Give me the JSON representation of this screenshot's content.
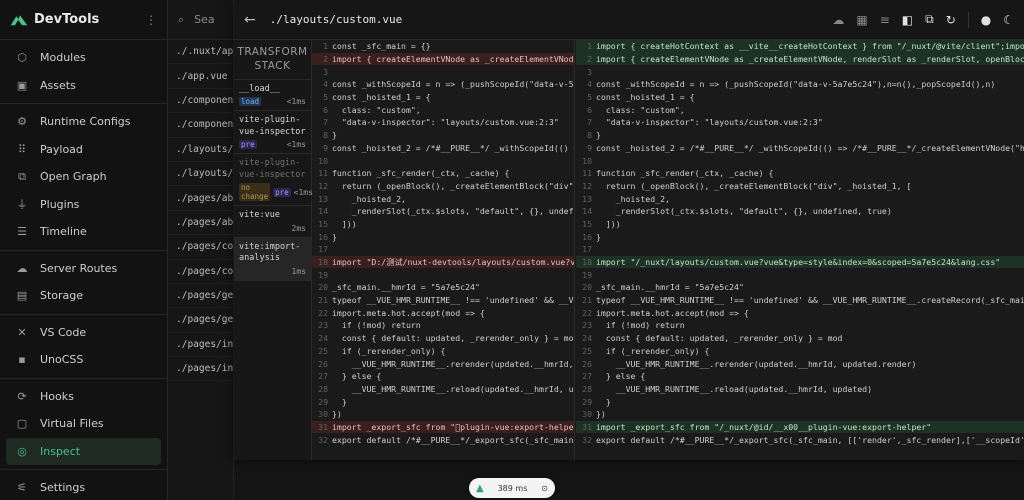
{
  "brand": {
    "name": "DevTools",
    "accent": "#47c38a"
  },
  "sidebar": {
    "groups": [
      [
        {
          "label": "Modules",
          "icon": "modules-icon"
        },
        {
          "label": "Assets",
          "icon": "assets-icon"
        }
      ],
      [
        {
          "label": "Runtime Configs",
          "icon": "gear-icon"
        },
        {
          "label": "Payload",
          "icon": "payload-icon"
        },
        {
          "label": "Open Graph",
          "icon": "open-graph-icon"
        },
        {
          "label": "Plugins",
          "icon": "plug-icon"
        },
        {
          "label": "Timeline",
          "icon": "timeline-icon"
        }
      ],
      [
        {
          "label": "Server Routes",
          "icon": "cloud-icon"
        },
        {
          "label": "Storage",
          "icon": "storage-icon"
        }
      ],
      [
        {
          "label": "VS Code",
          "icon": "vscode-icon"
        },
        {
          "label": "UnoCSS",
          "icon": "unocss-icon"
        }
      ],
      [
        {
          "label": "Hooks",
          "icon": "hooks-icon"
        },
        {
          "label": "Virtual Files",
          "icon": "virtual-files-icon"
        },
        {
          "label": "Inspect",
          "icon": "inspect-icon",
          "active": true
        }
      ],
      [
        {
          "label": "Settings",
          "icon": "settings-icon"
        }
      ]
    ]
  },
  "files": {
    "search_placeholder": "Sea",
    "items": [
      "./.nuxt/app",
      "./app.vue",
      "./components",
      "./components",
      "./layouts/c",
      "./layouts/de",
      "./pages/abo",
      "./pages/abo",
      "./pages/cont",
      "./pages/cont",
      "./pages/getE",
      "./pages/getE",
      "./pages/inde",
      "./pages/inde"
    ]
  },
  "panel": {
    "title": "./layouts/custom.vue",
    "stack_title": "TRANSFORM STACK",
    "stack": [
      {
        "name": "__load__",
        "badges": [
          {
            "text": "load",
            "kind": "load"
          }
        ],
        "ms": "<1ms"
      },
      {
        "name": "vite-plugin-vue-inspector",
        "badges": [
          {
            "text": "pre",
            "kind": "pre"
          }
        ],
        "ms": "<1ms"
      },
      {
        "name": "vite-plugin-vue-inspector",
        "badges": [
          {
            "text": "no change",
            "kind": "nochange"
          },
          {
            "text": "pre",
            "kind": "pre"
          }
        ],
        "ms": "<1ms",
        "dim": true
      },
      {
        "name": "vite:vue",
        "badges": [],
        "ms": "2ms"
      },
      {
        "name": "vite:import-analysis",
        "badges": [],
        "ms": "1ms",
        "active": true
      }
    ],
    "left_lines": [
      {
        "n": "1",
        "t": "const _sfc_main = {}",
        "k": ""
      },
      {
        "n": "2",
        "t": "import { createElementVNode as _createElementVNode, r",
        "k": "del"
      },
      {
        "n": "3",
        "t": "",
        "k": ""
      },
      {
        "n": "4",
        "t": "const _withScopeId = n => (_pushScopeId(\"data-v-5a7e",
        "k": ""
      },
      {
        "n": "5",
        "t": "const _hoisted_1 = {",
        "k": ""
      },
      {
        "n": "6",
        "t": "  class: \"custom\",",
        "k": ""
      },
      {
        "n": "7",
        "t": "  \"data-v-inspector\": \"layouts/custom.vue:2:3\"",
        "k": ""
      },
      {
        "n": "8",
        "t": "}",
        "k": ""
      },
      {
        "n": "9",
        "t": "const _hoisted_2 = /*#__PURE__*/ _withScopeId(() => /",
        "k": ""
      },
      {
        "n": "10",
        "t": "",
        "k": ""
      },
      {
        "n": "11",
        "t": "function _sfc_render(_ctx, _cache) {",
        "k": ""
      },
      {
        "n": "12",
        "t": "  return (_openBlock(), _createElementBlock(\"div\", _",
        "k": ""
      },
      {
        "n": "13",
        "t": "    _hoisted_2,",
        "k": ""
      },
      {
        "n": "14",
        "t": "    _renderSlot(_ctx.$slots, \"default\", {}, undefine",
        "k": ""
      },
      {
        "n": "15",
        "t": "  ]))",
        "k": ""
      },
      {
        "n": "16",
        "t": "}",
        "k": ""
      },
      {
        "n": "17",
        "t": "",
        "k": ""
      },
      {
        "n": "18",
        "t": "import \"D:/测试/nuxt-devtools/layouts/custom.vue?vue",
        "k": "del"
      },
      {
        "n": "19",
        "t": "",
        "k": ""
      },
      {
        "n": "20",
        "t": "_sfc_main.__hmrId = \"5a7e5c24\"",
        "k": ""
      },
      {
        "n": "21",
        "t": "typeof __VUE_HMR_RUNTIME__ !== 'undefined' && __VUE_",
        "k": ""
      },
      {
        "n": "22",
        "t": "import.meta.hot.accept(mod => {",
        "k": ""
      },
      {
        "n": "23",
        "t": "  if (!mod) return",
        "k": ""
      },
      {
        "n": "24",
        "t": "  const { default: updated, _rerender_only } = mod",
        "k": ""
      },
      {
        "n": "25",
        "t": "  if (_rerender_only) {",
        "k": ""
      },
      {
        "n": "26",
        "t": "    __VUE_HMR_RUNTIME__.rerender(updated.__hmrId, up",
        "k": ""
      },
      {
        "n": "27",
        "t": "  } else {",
        "k": ""
      },
      {
        "n": "28",
        "t": "    __VUE_HMR_RUNTIME__.reload(updated.__hmrId, upda",
        "k": ""
      },
      {
        "n": "29",
        "t": "  }",
        "k": ""
      },
      {
        "n": "30",
        "t": "})",
        "k": ""
      },
      {
        "n": "31",
        "t": "import _export_sfc from \"\u0000plugin-vue:export-helper\"",
        "k": "del"
      },
      {
        "n": "32",
        "t": "export default /*#__PURE__*/_export_sfc(_sfc_main, [",
        "k": ""
      }
    ],
    "right_lines": [
      {
        "n": "1",
        "t": "import { createHotContext as __vite__createHotContext } from \"/_nuxt/@vite/client\";impor",
        "k": "add"
      },
      {
        "n": "2",
        "t": "import { createElementVNode as _createElementVNode, renderSlot as _renderSlot, openBlock",
        "k": "add"
      },
      {
        "n": "3",
        "t": "",
        "k": ""
      },
      {
        "n": "4",
        "t": "const _withScopeId = n => (_pushScopeId(\"data-v-5a7e5c24\"),n=n(),_popScopeId(),n)",
        "k": ""
      },
      {
        "n": "5",
        "t": "const _hoisted_1 = {",
        "k": ""
      },
      {
        "n": "6",
        "t": "  class: \"custom\",",
        "k": ""
      },
      {
        "n": "7",
        "t": "  \"data-v-inspector\": \"layouts/custom.vue:2:3\"",
        "k": ""
      },
      {
        "n": "8",
        "t": "}",
        "k": ""
      },
      {
        "n": "9",
        "t": "const _hoisted_2 = /*#__PURE__*/ _withScopeId(() => /*#__PURE__*/_createElementVNode(\"h1",
        "k": ""
      },
      {
        "n": "10",
        "t": "",
        "k": ""
      },
      {
        "n": "11",
        "t": "function _sfc_render(_ctx, _cache) {",
        "k": ""
      },
      {
        "n": "12",
        "t": "  return (_openBlock(), _createElementBlock(\"div\", _hoisted_1, [",
        "k": ""
      },
      {
        "n": "13",
        "t": "    _hoisted_2,",
        "k": ""
      },
      {
        "n": "14",
        "t": "    _renderSlot(_ctx.$slots, \"default\", {}, undefined, true)",
        "k": ""
      },
      {
        "n": "15",
        "t": "  ]))",
        "k": ""
      },
      {
        "n": "16",
        "t": "}",
        "k": ""
      },
      {
        "n": "17",
        "t": "",
        "k": ""
      },
      {
        "n": "18",
        "t": "import \"/_nuxt/layouts/custom.vue?vue&type=style&index=0&scoped=5a7e5c24&lang.css\"",
        "k": "add"
      },
      {
        "n": "19",
        "t": "",
        "k": ""
      },
      {
        "n": "20",
        "t": "_sfc_main.__hmrId = \"5a7e5c24\"",
        "k": ""
      },
      {
        "n": "21",
        "t": "typeof __VUE_HMR_RUNTIME__ !== 'undefined' && __VUE_HMR_RUNTIME__.createRecord(_sfc_main",
        "k": ""
      },
      {
        "n": "22",
        "t": "import.meta.hot.accept(mod => {",
        "k": ""
      },
      {
        "n": "23",
        "t": "  if (!mod) return",
        "k": ""
      },
      {
        "n": "24",
        "t": "  const { default: updated, _rerender_only } = mod",
        "k": ""
      },
      {
        "n": "25",
        "t": "  if (_rerender_only) {",
        "k": ""
      },
      {
        "n": "26",
        "t": "    __VUE_HMR_RUNTIME__.rerender(updated.__hmrId, updated.render)",
        "k": ""
      },
      {
        "n": "27",
        "t": "  } else {",
        "k": ""
      },
      {
        "n": "28",
        "t": "    __VUE_HMR_RUNTIME__.reload(updated.__hmrId, updated)",
        "k": ""
      },
      {
        "n": "29",
        "t": "  }",
        "k": ""
      },
      {
        "n": "30",
        "t": "})",
        "k": ""
      },
      {
        "n": "31",
        "t": "import _export_sfc from \"/_nuxt/@id/__x00__plugin-vue:export-helper\"",
        "k": "add"
      },
      {
        "n": "32",
        "t": "export default /*#__PURE__*/_export_sfc(_sfc_main, [['render',_sfc_render],['__scopeId',",
        "k": ""
      }
    ]
  },
  "bottom": {
    "time": "389",
    "unit": "ms"
  }
}
